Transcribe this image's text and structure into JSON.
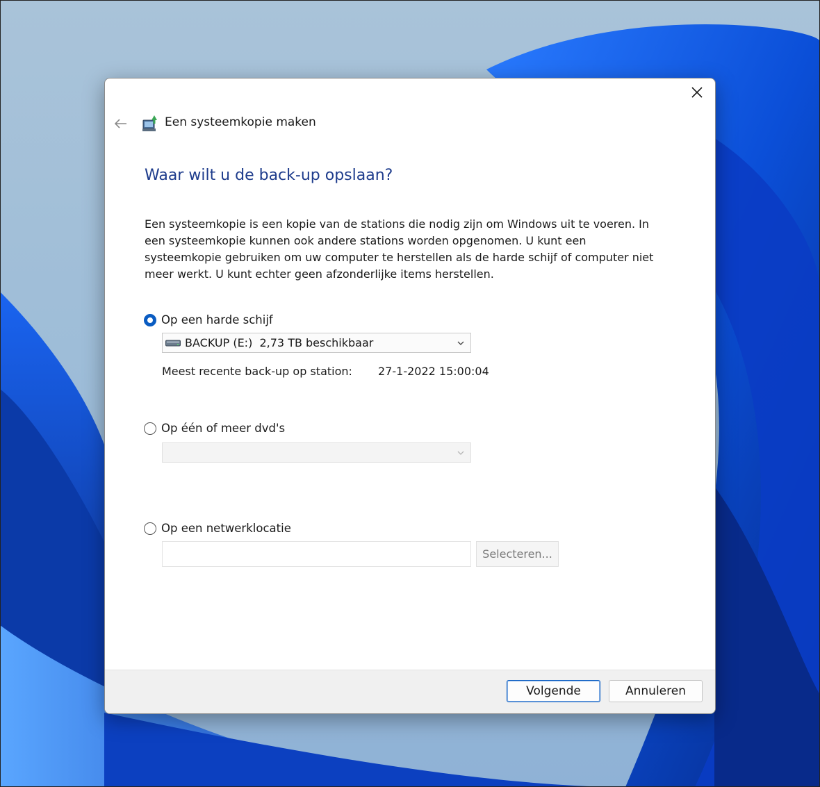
{
  "window": {
    "title": "Een systeemkopie maken"
  },
  "page": {
    "heading": "Waar wilt u de back-up opslaan?",
    "description": "Een systeemkopie is een kopie van de stations die nodig zijn om Windows uit te voeren. In een systeemkopie kunnen ook andere stations worden opgenomen. U kunt een systeemkopie gebruiken om uw computer te herstellen als de harde schijf of computer niet meer werkt. U kunt echter geen afzonderlijke items herstellen."
  },
  "options": {
    "hard_disk": {
      "label": "Op een harde schijf",
      "selected": true,
      "drive_value": "BACKUP (E:)  2,73 TB beschikbaar",
      "recent_label": "Meest recente back-up op station:",
      "recent_value": "27-1-2022 15:00:04"
    },
    "dvd": {
      "label": "Op één of meer dvd's",
      "selected": false,
      "drive_value": ""
    },
    "network": {
      "label": "Op een netwerklocatie",
      "selected": false,
      "path_value": "",
      "select_label": "Selecteren..."
    }
  },
  "footer": {
    "next_label": "Volgende",
    "cancel_label": "Annuleren"
  },
  "colors": {
    "accent": "#0a5cc2",
    "heading": "#1e3c8c"
  },
  "icons": {
    "close": "close-icon",
    "back": "back-arrow-icon",
    "app": "backup-app-icon",
    "drive": "hard-drive-icon",
    "dropdown": "chevron-down-icon"
  }
}
